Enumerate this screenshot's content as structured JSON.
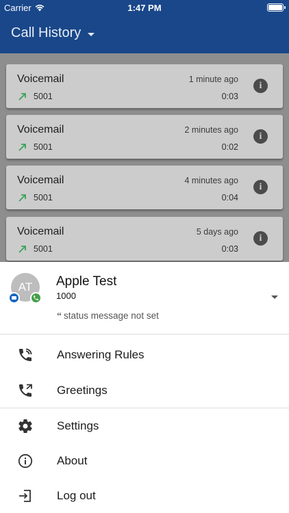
{
  "status_bar": {
    "carrier": "Carrier",
    "time": "1:47 PM"
  },
  "app_bar": {
    "title": "Call History"
  },
  "calls": [
    {
      "name": "Voicemail",
      "when": "1 minute ago",
      "number": "5001",
      "duration": "0:03"
    },
    {
      "name": "Voicemail",
      "when": "2 minutes ago",
      "number": "5001",
      "duration": "0:02"
    },
    {
      "name": "Voicemail",
      "when": "4 minutes ago",
      "number": "5001",
      "duration": "0:04"
    },
    {
      "name": "Voicemail",
      "when": "5 days ago",
      "number": "5001",
      "duration": "0:03"
    }
  ],
  "profile": {
    "initials": "AT",
    "name": "Apple Test",
    "extension": "1000",
    "status_message": "status message not set"
  },
  "menu": [
    {
      "label": "Answering Rules",
      "icon": "answering-rules-icon"
    },
    {
      "label": "Greetings",
      "icon": "greetings-icon"
    },
    {
      "label": "Settings",
      "icon": "gear-icon"
    },
    {
      "label": "About",
      "icon": "info-icon"
    },
    {
      "label": "Log out",
      "icon": "logout-icon"
    }
  ],
  "colors": {
    "app_bar": "#19478a",
    "outgoing_arrow": "#3aa35a",
    "chat_badge": "#1565c0",
    "phone_badge": "#43a047"
  }
}
